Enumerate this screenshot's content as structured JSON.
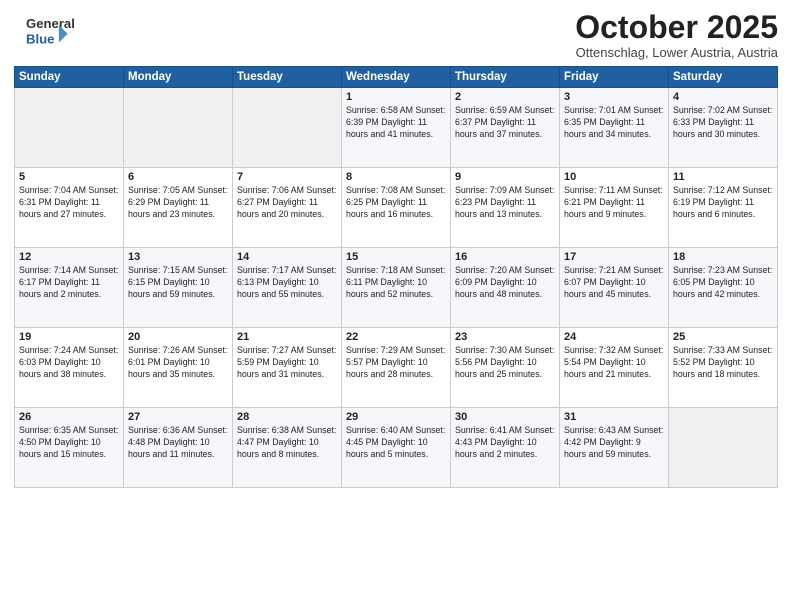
{
  "header": {
    "logo_line1": "General",
    "logo_line2": "Blue",
    "month": "October 2025",
    "location": "Ottenschlag, Lower Austria, Austria"
  },
  "weekdays": [
    "Sunday",
    "Monday",
    "Tuesday",
    "Wednesday",
    "Thursday",
    "Friday",
    "Saturday"
  ],
  "weeks": [
    [
      {
        "day": "",
        "info": ""
      },
      {
        "day": "",
        "info": ""
      },
      {
        "day": "",
        "info": ""
      },
      {
        "day": "1",
        "info": "Sunrise: 6:58 AM\nSunset: 6:39 PM\nDaylight: 11 hours\nand 41 minutes."
      },
      {
        "day": "2",
        "info": "Sunrise: 6:59 AM\nSunset: 6:37 PM\nDaylight: 11 hours\nand 37 minutes."
      },
      {
        "day": "3",
        "info": "Sunrise: 7:01 AM\nSunset: 6:35 PM\nDaylight: 11 hours\nand 34 minutes."
      },
      {
        "day": "4",
        "info": "Sunrise: 7:02 AM\nSunset: 6:33 PM\nDaylight: 11 hours\nand 30 minutes."
      }
    ],
    [
      {
        "day": "5",
        "info": "Sunrise: 7:04 AM\nSunset: 6:31 PM\nDaylight: 11 hours\nand 27 minutes."
      },
      {
        "day": "6",
        "info": "Sunrise: 7:05 AM\nSunset: 6:29 PM\nDaylight: 11 hours\nand 23 minutes."
      },
      {
        "day": "7",
        "info": "Sunrise: 7:06 AM\nSunset: 6:27 PM\nDaylight: 11 hours\nand 20 minutes."
      },
      {
        "day": "8",
        "info": "Sunrise: 7:08 AM\nSunset: 6:25 PM\nDaylight: 11 hours\nand 16 minutes."
      },
      {
        "day": "9",
        "info": "Sunrise: 7:09 AM\nSunset: 6:23 PM\nDaylight: 11 hours\nand 13 minutes."
      },
      {
        "day": "10",
        "info": "Sunrise: 7:11 AM\nSunset: 6:21 PM\nDaylight: 11 hours\nand 9 minutes."
      },
      {
        "day": "11",
        "info": "Sunrise: 7:12 AM\nSunset: 6:19 PM\nDaylight: 11 hours\nand 6 minutes."
      }
    ],
    [
      {
        "day": "12",
        "info": "Sunrise: 7:14 AM\nSunset: 6:17 PM\nDaylight: 11 hours\nand 2 minutes."
      },
      {
        "day": "13",
        "info": "Sunrise: 7:15 AM\nSunset: 6:15 PM\nDaylight: 10 hours\nand 59 minutes."
      },
      {
        "day": "14",
        "info": "Sunrise: 7:17 AM\nSunset: 6:13 PM\nDaylight: 10 hours\nand 55 minutes."
      },
      {
        "day": "15",
        "info": "Sunrise: 7:18 AM\nSunset: 6:11 PM\nDaylight: 10 hours\nand 52 minutes."
      },
      {
        "day": "16",
        "info": "Sunrise: 7:20 AM\nSunset: 6:09 PM\nDaylight: 10 hours\nand 48 minutes."
      },
      {
        "day": "17",
        "info": "Sunrise: 7:21 AM\nSunset: 6:07 PM\nDaylight: 10 hours\nand 45 minutes."
      },
      {
        "day": "18",
        "info": "Sunrise: 7:23 AM\nSunset: 6:05 PM\nDaylight: 10 hours\nand 42 minutes."
      }
    ],
    [
      {
        "day": "19",
        "info": "Sunrise: 7:24 AM\nSunset: 6:03 PM\nDaylight: 10 hours\nand 38 minutes."
      },
      {
        "day": "20",
        "info": "Sunrise: 7:26 AM\nSunset: 6:01 PM\nDaylight: 10 hours\nand 35 minutes."
      },
      {
        "day": "21",
        "info": "Sunrise: 7:27 AM\nSunset: 5:59 PM\nDaylight: 10 hours\nand 31 minutes."
      },
      {
        "day": "22",
        "info": "Sunrise: 7:29 AM\nSunset: 5:57 PM\nDaylight: 10 hours\nand 28 minutes."
      },
      {
        "day": "23",
        "info": "Sunrise: 7:30 AM\nSunset: 5:56 PM\nDaylight: 10 hours\nand 25 minutes."
      },
      {
        "day": "24",
        "info": "Sunrise: 7:32 AM\nSunset: 5:54 PM\nDaylight: 10 hours\nand 21 minutes."
      },
      {
        "day": "25",
        "info": "Sunrise: 7:33 AM\nSunset: 5:52 PM\nDaylight: 10 hours\nand 18 minutes."
      }
    ],
    [
      {
        "day": "26",
        "info": "Sunrise: 6:35 AM\nSunset: 4:50 PM\nDaylight: 10 hours\nand 15 minutes."
      },
      {
        "day": "27",
        "info": "Sunrise: 6:36 AM\nSunset: 4:48 PM\nDaylight: 10 hours\nand 11 minutes."
      },
      {
        "day": "28",
        "info": "Sunrise: 6:38 AM\nSunset: 4:47 PM\nDaylight: 10 hours\nand 8 minutes."
      },
      {
        "day": "29",
        "info": "Sunrise: 6:40 AM\nSunset: 4:45 PM\nDaylight: 10 hours\nand 5 minutes."
      },
      {
        "day": "30",
        "info": "Sunrise: 6:41 AM\nSunset: 4:43 PM\nDaylight: 10 hours\nand 2 minutes."
      },
      {
        "day": "31",
        "info": "Sunrise: 6:43 AM\nSunset: 4:42 PM\nDaylight: 9 hours\nand 59 minutes."
      },
      {
        "day": "",
        "info": ""
      }
    ]
  ]
}
